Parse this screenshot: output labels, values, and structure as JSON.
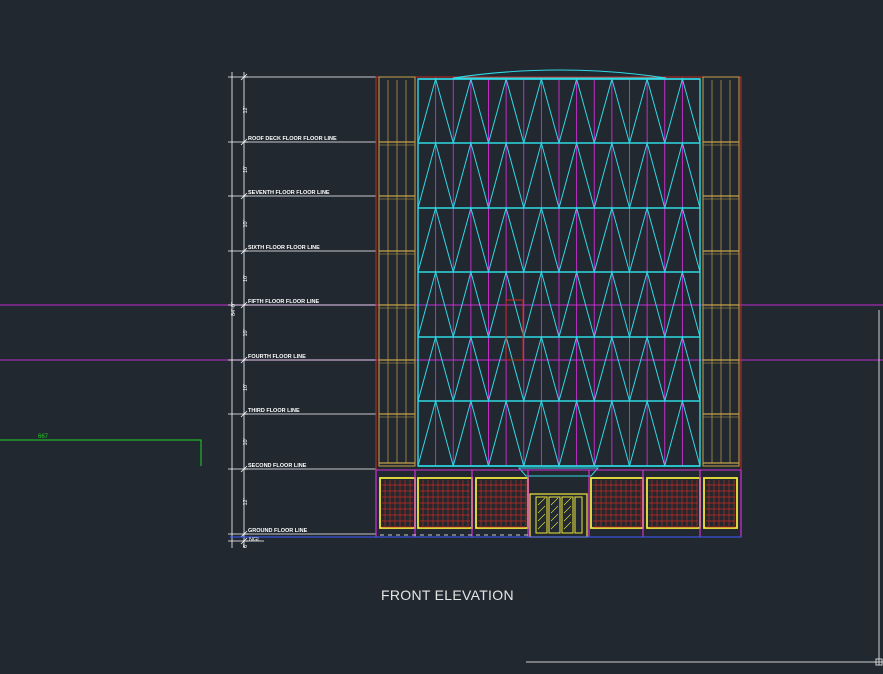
{
  "drawing": {
    "title": "FRONT ELEVATION",
    "total_height_label": "84'-0\"",
    "ngl_label": "NGL",
    "left_marker_label": "667",
    "floor_lines": [
      {
        "label": "ROOF DECK FLOOR FLOOR LINE",
        "dim_above": "12'"
      },
      {
        "label": "SEVENTH FLOOR FLOOR LINE",
        "dim_above": "10'"
      },
      {
        "label": "SIXTH FLOOR FLOOR LINE",
        "dim_above": "10'"
      },
      {
        "label": "FIFTH FLOOR FLOOR LINE",
        "dim_above": "10'"
      },
      {
        "label": "FOURTH FLOOR LINE",
        "dim_above": "10'"
      },
      {
        "label": "THIRD FLOOR LINE",
        "dim_above": "10'"
      },
      {
        "label": "SECOND FLOOR LINE",
        "dim_above": "10'"
      },
      {
        "label": "GROUND FLOOR LINE",
        "dim_above": "12'"
      }
    ],
    "bottom_dim": "6'",
    "colors": {
      "background": "#212830",
      "glazing_frame": "#2fd9e6",
      "mullion": "#d22fd8",
      "column": "#c8a24a",
      "outline": "#c8281e",
      "storefront": "#f0e63c",
      "guide_line": "#c02ed0",
      "marker": "#1fd21f"
    }
  }
}
